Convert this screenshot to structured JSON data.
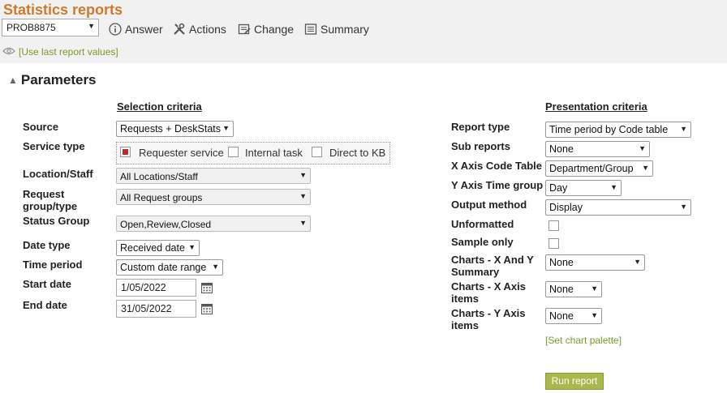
{
  "header": {
    "title": "Statistics reports",
    "problem_id": "PROB8875",
    "toolbar": [
      {
        "label": "Answer",
        "icon": "info-icon"
      },
      {
        "label": "Actions",
        "icon": "tools-icon"
      },
      {
        "label": "Change",
        "icon": "edit-icon"
      },
      {
        "label": "Summary",
        "icon": "summary-icon"
      }
    ],
    "use_last": "[Use last report values]"
  },
  "section_title": "Parameters",
  "selection": {
    "title": "Selection criteria",
    "source": {
      "label": "Source",
      "value": "Requests + DeskStats"
    },
    "service_type": {
      "label": "Service type",
      "options": [
        {
          "label": "Requester service",
          "checked": true
        },
        {
          "label": "Internal task",
          "checked": false
        },
        {
          "label": "Direct to KB",
          "checked": false
        }
      ]
    },
    "location": {
      "label": "Location/Staff",
      "value": "All Locations/Staff"
    },
    "request_group": {
      "label": "Request group/type",
      "value": "All Request groups"
    },
    "status_group": {
      "label": "Status Group",
      "value": "Open,Review,Closed"
    },
    "date_type": {
      "label": "Date type",
      "value": "Received date"
    },
    "time_period": {
      "label": "Time period",
      "value": "Custom date range"
    },
    "start_date": {
      "label": "Start date",
      "value": "1/05/2022"
    },
    "end_date": {
      "label": "End date",
      "value": "31/05/2022"
    }
  },
  "presentation": {
    "title": "Presentation criteria",
    "report_type": {
      "label": "Report type",
      "value": "Time period by Code table"
    },
    "sub_reports": {
      "label": "Sub reports",
      "value": "None"
    },
    "x_axis": {
      "label": "X Axis Code Table",
      "value": "Department/Group"
    },
    "y_axis": {
      "label": "Y Axis Time group",
      "value": "Day"
    },
    "output": {
      "label": "Output method",
      "value": "Display"
    },
    "unformatted": {
      "label": "Unformatted",
      "checked": false
    },
    "sample_only": {
      "label": "Sample only",
      "checked": false
    },
    "charts_xy": {
      "label": "Charts - X And Y Summary",
      "value": "None"
    },
    "charts_x": {
      "label": "Charts - X Axis items",
      "value": "None"
    },
    "charts_y": {
      "label": "Charts - Y Axis items",
      "value": "None"
    },
    "palette": "[Set chart palette]",
    "run": "Run report"
  },
  "colors": {
    "title": "#d07a2c",
    "link": "#7a9a2a",
    "run_button": "#a8b84a",
    "checked": "#c0282a"
  }
}
